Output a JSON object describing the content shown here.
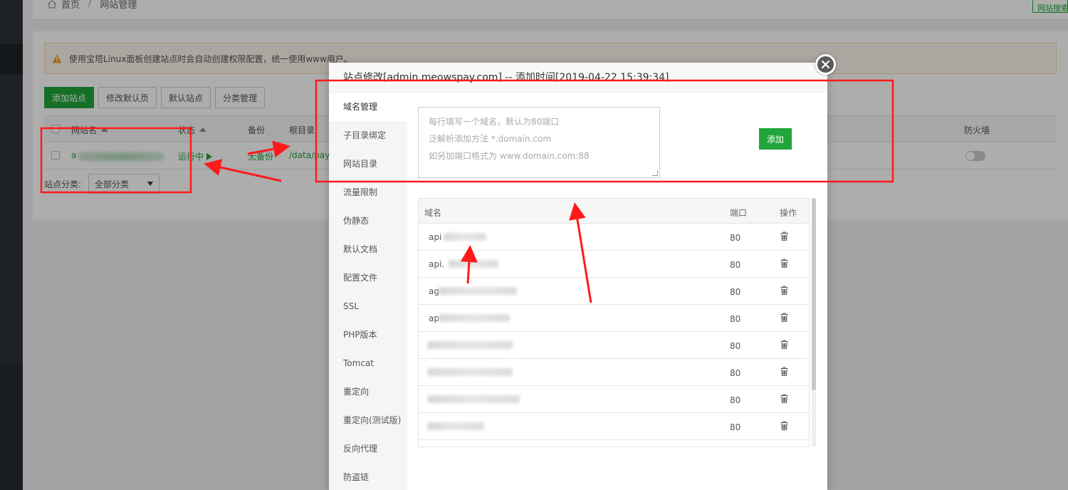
{
  "breadcrumb": {
    "home": "首页",
    "current": "网站管理"
  },
  "topbar_button": "网站搜索",
  "notice": "使用宝塔Linux面板创建站点时会自动创建权限配置，统一使用www用户。",
  "toolbar": {
    "add_site": "添加站点",
    "edit_default_page": "修改默认页",
    "default_site": "默认站点",
    "category_manage": "分类管理"
  },
  "site_table": {
    "headers": {
      "name": "网站名",
      "status": "状态",
      "backup": "备份",
      "root": "根目录",
      "firewall": "防火墙"
    },
    "row": {
      "name_prefix": "a",
      "status": "运行中",
      "backup": "无备份",
      "root": "/data/pay"
    }
  },
  "category": {
    "label": "站点分类:",
    "value": "全部分类"
  },
  "modal": {
    "title": "站点修改[admin.meowspay.com] -- 添加时间[2019-04-22 15:39:34]",
    "nav": [
      "域名管理",
      "子目录绑定",
      "网站目录",
      "流量限制",
      "伪静态",
      "默认文档",
      "配置文件",
      "SSL",
      "PHP版本",
      "Tomcat",
      "重定向",
      "重定向(测试版)",
      "反向代理",
      "防盗链"
    ],
    "placeholder_lines": [
      "每行填写一个域名，默认为80端口",
      "泛解析添加方法 *.domain.com",
      "如另加端口格式为 www.domain.com:88"
    ],
    "add_button": "添加",
    "domain_table": {
      "headers": {
        "domain": "域名",
        "port": "端口",
        "action": "操作"
      },
      "rows": [
        {
          "prefix": "api",
          "port": "80"
        },
        {
          "prefix": "api.",
          "port": "80"
        },
        {
          "prefix": "ag",
          "port": "80"
        },
        {
          "prefix": "ap",
          "port": "80"
        },
        {
          "prefix": "",
          "port": "80"
        },
        {
          "prefix": "",
          "port": "80"
        },
        {
          "prefix": "",
          "port": "80"
        },
        {
          "prefix": "",
          "port": "80"
        }
      ]
    }
  },
  "colors": {
    "primary_green": "#20a53a",
    "annotation_red": "#ff1a1a"
  }
}
